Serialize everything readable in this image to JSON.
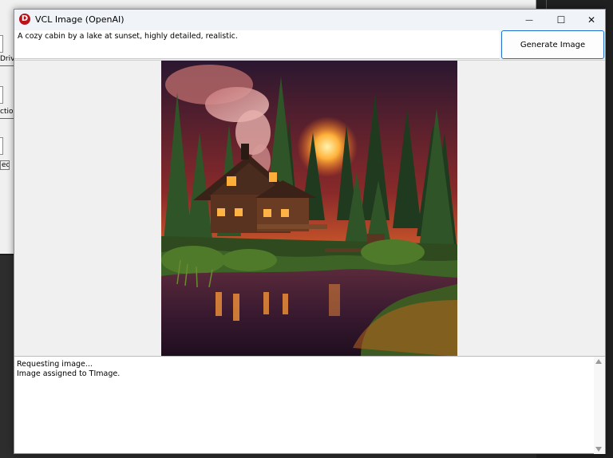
{
  "background_window": {
    "labels": [
      "Driv",
      "ctio",
      "eq"
    ]
  },
  "window": {
    "title": "VCL Image (OpenAI)",
    "app_icon_letter": "D",
    "minimize_glyph": "—",
    "maximize_glyph": "☐",
    "close_glyph": "✕"
  },
  "prompt": {
    "value": "A cozy cabin by a lake at sunset, highly detailed, realistic."
  },
  "toolbar": {
    "generate_label": "Generate Image"
  },
  "image": {
    "description_icon": "generated-cabin-image"
  },
  "log": {
    "lines": [
      "Requesting image...",
      "Image assigned to TImage."
    ]
  },
  "colors": {
    "accent": "#1e6fd0",
    "titlebar": "#f0f4f9",
    "window_bg": "#f0f0f0"
  }
}
